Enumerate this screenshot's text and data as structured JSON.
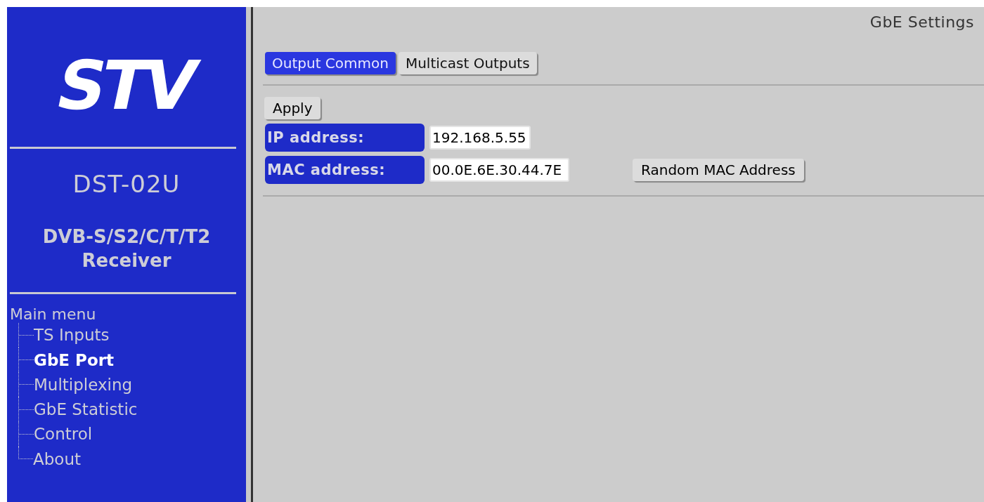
{
  "sidebar": {
    "logo": "STV",
    "model": "DST-02U",
    "description": "DVB-S/S2/C/T/T2 Receiver",
    "menu": {
      "title": "Main menu",
      "items": [
        {
          "label": "TS Inputs",
          "selected": false
        },
        {
          "label": "GbE Port",
          "selected": true
        },
        {
          "label": "Multiplexing",
          "selected": false
        },
        {
          "label": "GbE Statistic",
          "selected": false
        },
        {
          "label": "Control",
          "selected": false
        },
        {
          "label": "About",
          "selected": false
        }
      ]
    }
  },
  "main": {
    "title": "GbE Settings",
    "tabs": [
      {
        "label": "Output Common",
        "selected": true
      },
      {
        "label": "Multicast Outputs",
        "selected": false
      }
    ],
    "apply_button": "Apply",
    "fields": [
      {
        "label": "IP address:",
        "value": "192.168.5.55"
      },
      {
        "label": "MAC address:",
        "value": "00.0E.6E.30.44.7E",
        "button": "Random MAC Address"
      }
    ]
  }
}
